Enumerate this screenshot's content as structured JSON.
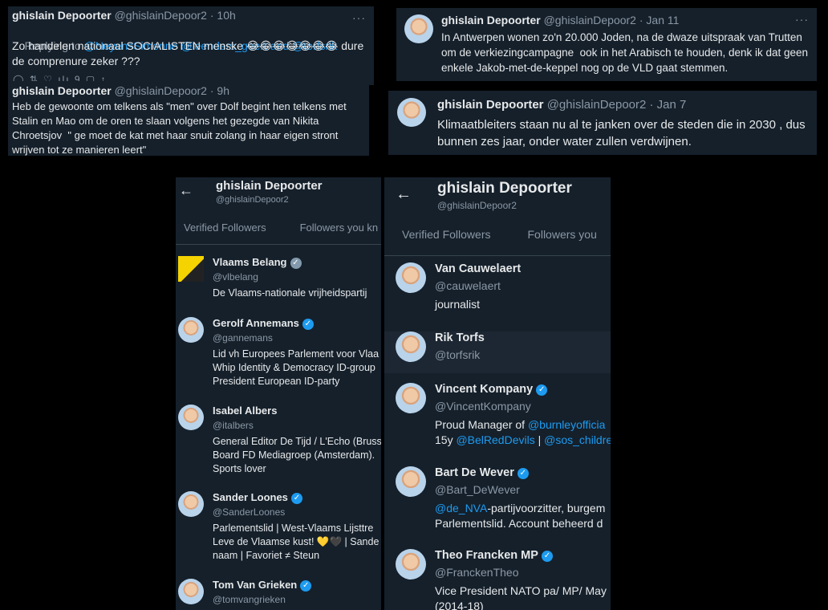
{
  "tweet1": {
    "name": "ghislain Depoorter",
    "handle": "@ghislainDepoor2 · 10h",
    "reply_prefix": "Replying to ",
    "reply_users": "@NeyensSimonne @leenders_geert and @torfsrik",
    "text": "Zo handelen nationaal SOCIALISTEN menske 😂😂😂😂😂😂😂 dure de comprenure zeker ???",
    "actions": "◯   ⇅   ♡   ılı 9   ▢   ↑"
  },
  "tweet2": {
    "name": "ghislain Depoorter",
    "handle": "@ghislainDepoor2 · 9h",
    "text": "Heb de gewoonte om telkens als \"men\" over Dolf begint hen telkens met Stalin en Mao om de oren te slaan volgens het gezegde van Nikita Chroetsjov  \" ge moet de kat met haar snuit zolang in haar eigen stront wrijven tot ze manieren leert\""
  },
  "tweet3": {
    "name": "ghislain Depoorter",
    "handle": "@ghislainDepoor2 · Jan 11",
    "text": "In Antwerpen wonen zo'n 20.000 Joden, na de dwaze uitspraak van Trutten om de verkiezingcampagne  ook in het Arabisch te houden, denk ik dat geen enkele Jakob-met-de-keppel nog op de VLD gaat stemmen."
  },
  "tweet4": {
    "name": "ghislain Depoorter",
    "handle": "@ghislainDepoor2 · Jan 7",
    "text": "Klimaatbleiters staan nu al te janken over de steden die in 2030 , dus bunnen zes jaar, onder water zullen verdwijnen."
  },
  "more_icon": "···",
  "back_icon": "←",
  "left_panel": {
    "name": "ghislain Depoorter",
    "handle": "@ghislainDepoor2",
    "tabs": [
      "Verified Followers",
      "Followers you kn"
    ],
    "followers": [
      {
        "name": "Vlaams Belang",
        "badge": "gray",
        "handle": "@vlbelang",
        "bio": [
          "De Vlaams-nationale vrijheidspartij"
        ]
      },
      {
        "name": "Gerolf Annemans",
        "badge": "blue",
        "handle": "@gannemans",
        "bio": [
          "Lid vh Europees Parlement voor Vlaa",
          "Whip Identity & Democracy ID-group",
          "President European ID-party"
        ]
      },
      {
        "name": "Isabel Albers",
        "badge": "",
        "handle": "@italbers",
        "bio": [
          "General Editor De Tijd / L'Echo (Bruss",
          "Board FD Mediagroep (Amsterdam).",
          "Sports lover"
        ]
      },
      {
        "name": "Sander Loones",
        "badge": "blue",
        "handle": "@SanderLoones",
        "bio": [
          "Parlementslid | West-Vlaams Lijsttre",
          "Leve de Vlaamse kust! 💛🖤 | Sande",
          "naam | Favoriet ≠ Steun"
        ]
      },
      {
        "name": "Tom Van Grieken",
        "badge": "blue",
        "handle": "@tomvangrieken",
        "bio": []
      }
    ]
  },
  "right_panel": {
    "name": "ghislain Depoorter",
    "handle": "@ghislainDepoor2",
    "tabs": [
      "Verified Followers",
      "Followers you"
    ],
    "followers": [
      {
        "name": "Van Cauwelaert",
        "badge": "",
        "handle": "@cauwelaert",
        "bio": [
          "journalist"
        ]
      },
      {
        "name": "Rik Torfs",
        "badge": "",
        "handle": "@torfsrik",
        "bio": []
      },
      {
        "name": "Vincent Kompany",
        "badge": "blue",
        "handle": "@VincentKompany",
        "bio_rich": [
          {
            "t": "Proud Manager of ",
            "link": false
          },
          {
            "t": "@burnleyofficia",
            "link": true
          }
        ],
        "bio_rich2": [
          {
            "t": "15y ",
            "link": false
          },
          {
            "t": "@BelRedDevils",
            "link": true
          },
          {
            "t": " | ",
            "link": false
          },
          {
            "t": "@sos_childre",
            "link": true
          }
        ]
      },
      {
        "name": "Bart De Wever",
        "badge": "blue",
        "handle": "@Bart_DeWever",
        "bio_rich": [
          {
            "t": "@de_NVA",
            "link": true
          },
          {
            "t": "-partijvoorzitter, burgem",
            "link": false
          }
        ],
        "bio2": "Parlementslid. Account beheerd d"
      },
      {
        "name": "Theo Francken MP",
        "badge": "blue",
        "handle": "@FranckenTheo",
        "bio": [
          "Vice President NATO pa/ MP/ May",
          "(2014-18)"
        ]
      }
    ]
  },
  "colors": {
    "bg": "#15202b",
    "text": "#e7e9ea",
    "muted": "#8b98a5",
    "link": "#1d9bf0",
    "badge": "#1d9bf0"
  }
}
